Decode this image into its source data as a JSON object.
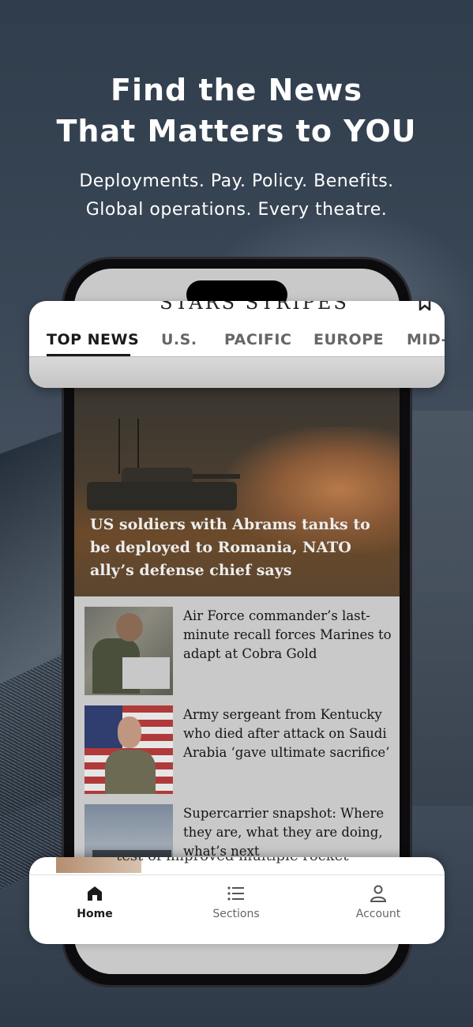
{
  "promo": {
    "headline_line1": "Find the News",
    "headline_line2": "That Matters to YOU",
    "subline_line1": "Deployments. Pay. Policy. Benefits.",
    "subline_line2": "Global operations. Every theatre."
  },
  "app": {
    "masthead": "STARS STRIPES",
    "bookmark_icon": "bookmark-icon"
  },
  "tabs": [
    {
      "label": "TOP NEWS",
      "active": true
    },
    {
      "label": "U.S.",
      "active": false
    },
    {
      "label": "PACIFIC",
      "active": false
    },
    {
      "label": "EUROPE",
      "active": false
    },
    {
      "label": "MID-",
      "active": false
    }
  ],
  "hero": {
    "title": "US soldiers with Abrams tanks to be deployed to Romania, NATO ally’s defense chief says"
  },
  "articles": [
    {
      "title": "Air Force commander’s last-minute recall forces Marines to adapt at Cobra Gold"
    },
    {
      "title": "Army sergeant from Kentucky who died after attack on Saudi Arabia ‘gave ultimate sacrifice’"
    },
    {
      "title": "Supercarrier snapshot: Where they are, what they are doing, what’s next"
    }
  ],
  "peek_article": {
    "title": "test of improved multiple rocket"
  },
  "bottom_nav": [
    {
      "label": "Home",
      "icon": "home-icon",
      "active": true
    },
    {
      "label": "Sections",
      "icon": "list-icon",
      "active": false
    },
    {
      "label": "Account",
      "icon": "user-icon",
      "active": false
    }
  ],
  "colors": {
    "background": "#3a4756",
    "active_tab": "#1a1a1a",
    "inactive_tab": "#666666"
  }
}
